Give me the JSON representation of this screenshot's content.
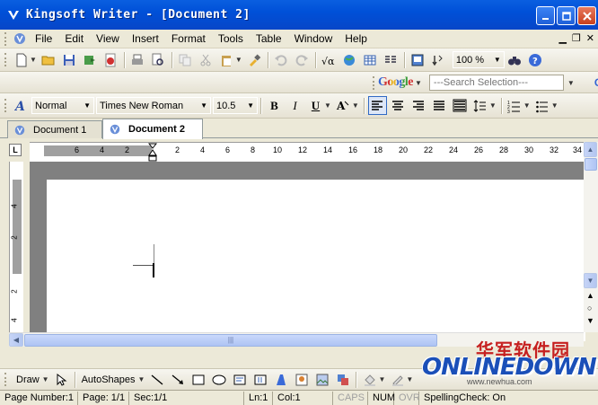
{
  "window": {
    "title": "Kingsoft Writer - [Document 2]"
  },
  "menu": {
    "items": [
      "File",
      "Edit",
      "View",
      "Insert",
      "Format",
      "Tools",
      "Table",
      "Window",
      "Help"
    ]
  },
  "toolbar": {
    "zoom": "100 %"
  },
  "format": {
    "style": "Normal",
    "font": "Times New Roman",
    "size": "10.5",
    "bold": "B",
    "italic": "I",
    "underline": "U"
  },
  "google": {
    "logo": "Google",
    "search_placeholder": "---Search Selection---",
    "btn_label": "G"
  },
  "tabs": [
    {
      "label": "Document 1",
      "active": false
    },
    {
      "label": "Document 2",
      "active": true
    }
  ],
  "ruler": {
    "h_ticks": [
      "6",
      "4",
      "2",
      "2",
      "4",
      "6",
      "8",
      "10",
      "12",
      "14",
      "16",
      "18",
      "20",
      "22",
      "24",
      "26",
      "28",
      "30",
      "32",
      "34"
    ],
    "v_ticks": [
      "4",
      "2",
      "2",
      "4"
    ],
    "corner": "L"
  },
  "drawbar": {
    "draw_label": "Draw",
    "autoshapes_label": "AutoShapes"
  },
  "status": {
    "page_number": "Page Number:1",
    "page": "Page: 1/1",
    "sec": "Sec:1/1",
    "ln": "Ln:1",
    "col": "Col:1",
    "caps": "CAPS",
    "num": "NUM",
    "ovr": "OVR",
    "spell": "SpellingCheck: On"
  },
  "watermark": {
    "cn": "华军软件园",
    "en": "ONLINEDOWN",
    "url": "www.newhua.com"
  },
  "colors": {
    "titlebar": "#0050d8",
    "workspace": "#808080",
    "accent": "#316ac5"
  }
}
